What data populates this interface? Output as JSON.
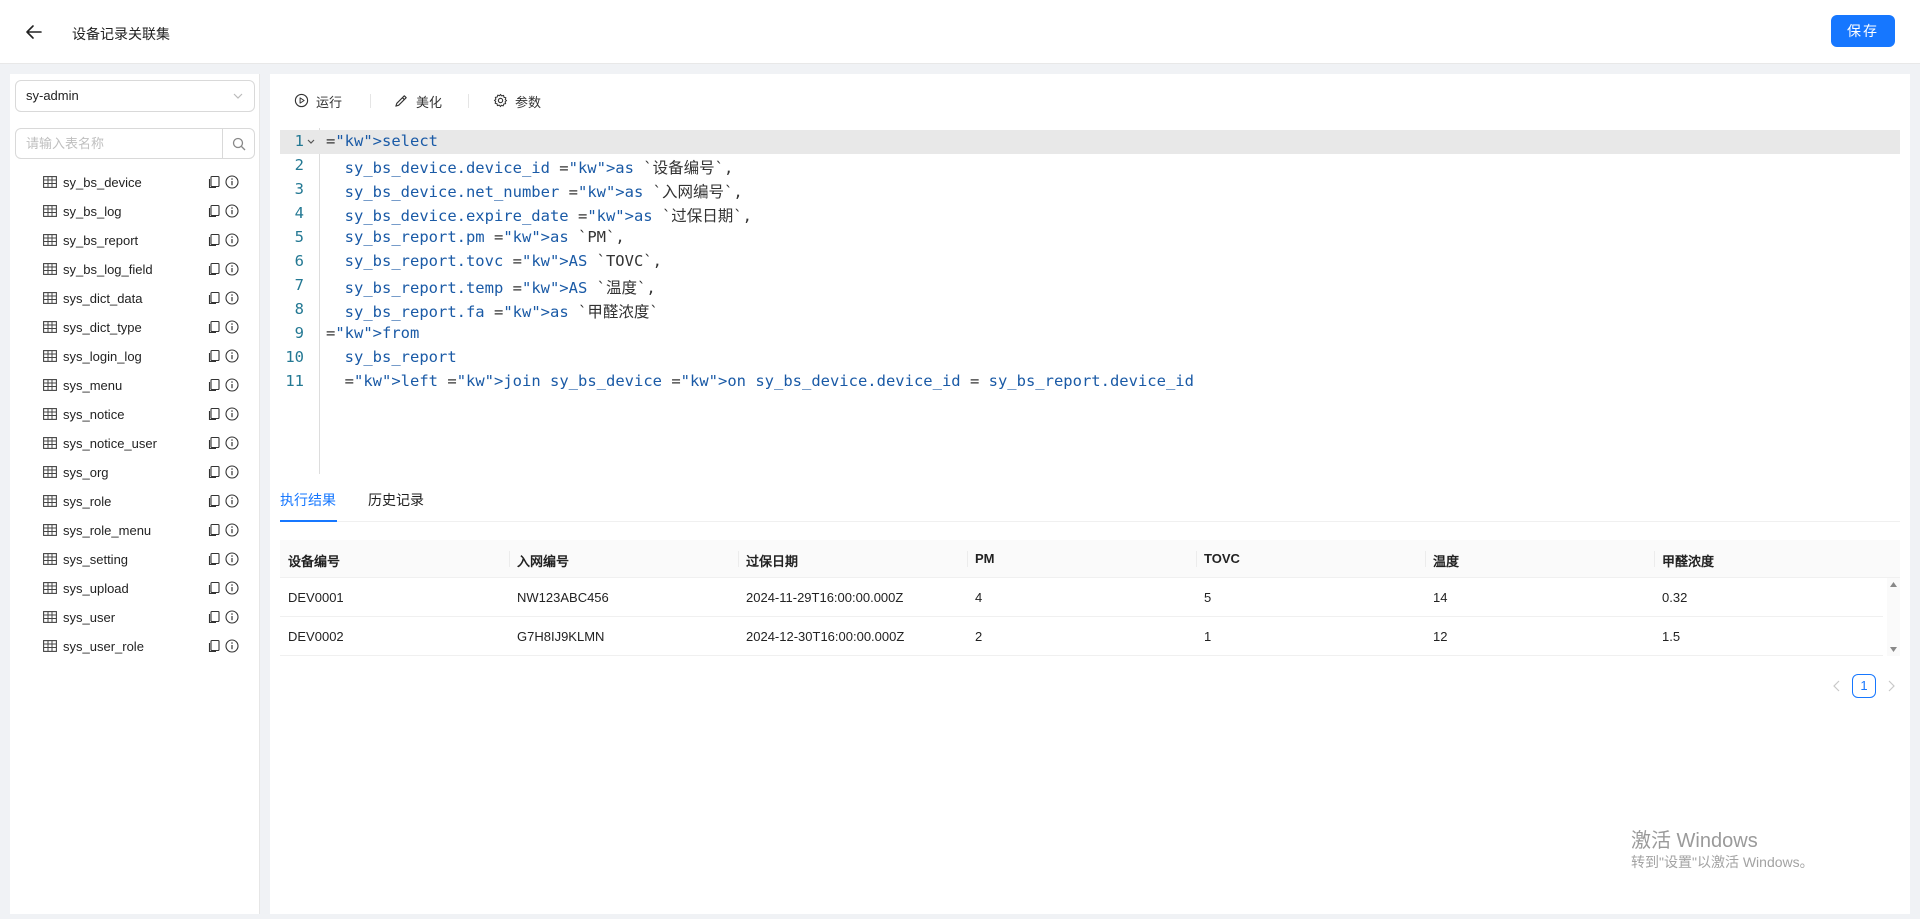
{
  "header": {
    "title": "设备记录关联集",
    "save_label": "保存"
  },
  "sidebar": {
    "database": "sy-admin",
    "search_placeholder": "请输入表名称",
    "tables": [
      "sy_bs_device",
      "sy_bs_log",
      "sy_bs_report",
      "sy_bs_log_field",
      "sys_dict_data",
      "sys_dict_type",
      "sys_login_log",
      "sys_menu",
      "sys_notice",
      "sys_notice_user",
      "sys_org",
      "sys_role",
      "sys_role_menu",
      "sys_setting",
      "sys_upload",
      "sys_user",
      "sys_user_role"
    ]
  },
  "toolbar": {
    "run_label": "运行",
    "format_label": "美化",
    "params_label": "参数"
  },
  "editor": {
    "lines": [
      {
        "no": "1",
        "text": "select"
      },
      {
        "no": "2",
        "text": "  sy_bs_device.device_id as `设备编号`,"
      },
      {
        "no": "3",
        "text": "  sy_bs_device.net_number as `入网编号`,"
      },
      {
        "no": "4",
        "text": "  sy_bs_device.expire_date as `过保日期`,"
      },
      {
        "no": "5",
        "text": "  sy_bs_report.pm as `PM`,"
      },
      {
        "no": "6",
        "text": "  sy_bs_report.tovc AS `TOVC`,"
      },
      {
        "no": "7",
        "text": "  sy_bs_report.temp AS `温度`,"
      },
      {
        "no": "8",
        "text": "  sy_bs_report.fa as `甲醛浓度`"
      },
      {
        "no": "9",
        "text": "from"
      },
      {
        "no": "10",
        "text": "  sy_bs_report"
      },
      {
        "no": "11",
        "text": "  left join sy_bs_device on sy_bs_device.device_id = sy_bs_report.device_id"
      }
    ]
  },
  "tabs": {
    "results": "执行结果",
    "history": "历史记录"
  },
  "results": {
    "columns": [
      "设备编号",
      "入网编号",
      "过保日期",
      "PM",
      "TOVC",
      "温度",
      "甲醛浓度"
    ],
    "rows": [
      [
        "DEV0001",
        "NW123ABC456",
        "2024-11-29T16:00:00.000Z",
        "4",
        "5",
        "14",
        "0.32"
      ],
      [
        "DEV0002",
        "G7H8IJ9KLMN",
        "2024-12-30T16:00:00.000Z",
        "2",
        "1",
        "12",
        "1.5"
      ]
    ]
  },
  "pagination": {
    "current": "1"
  },
  "watermark": {
    "title": "激活 Windows",
    "subtitle": "转到\"设置\"以激活 Windows。"
  },
  "colors": {
    "primary": "#1677ff",
    "keyword": "#1a1aa6",
    "identifier": "#2a5cb0",
    "line_number": "#237893"
  }
}
